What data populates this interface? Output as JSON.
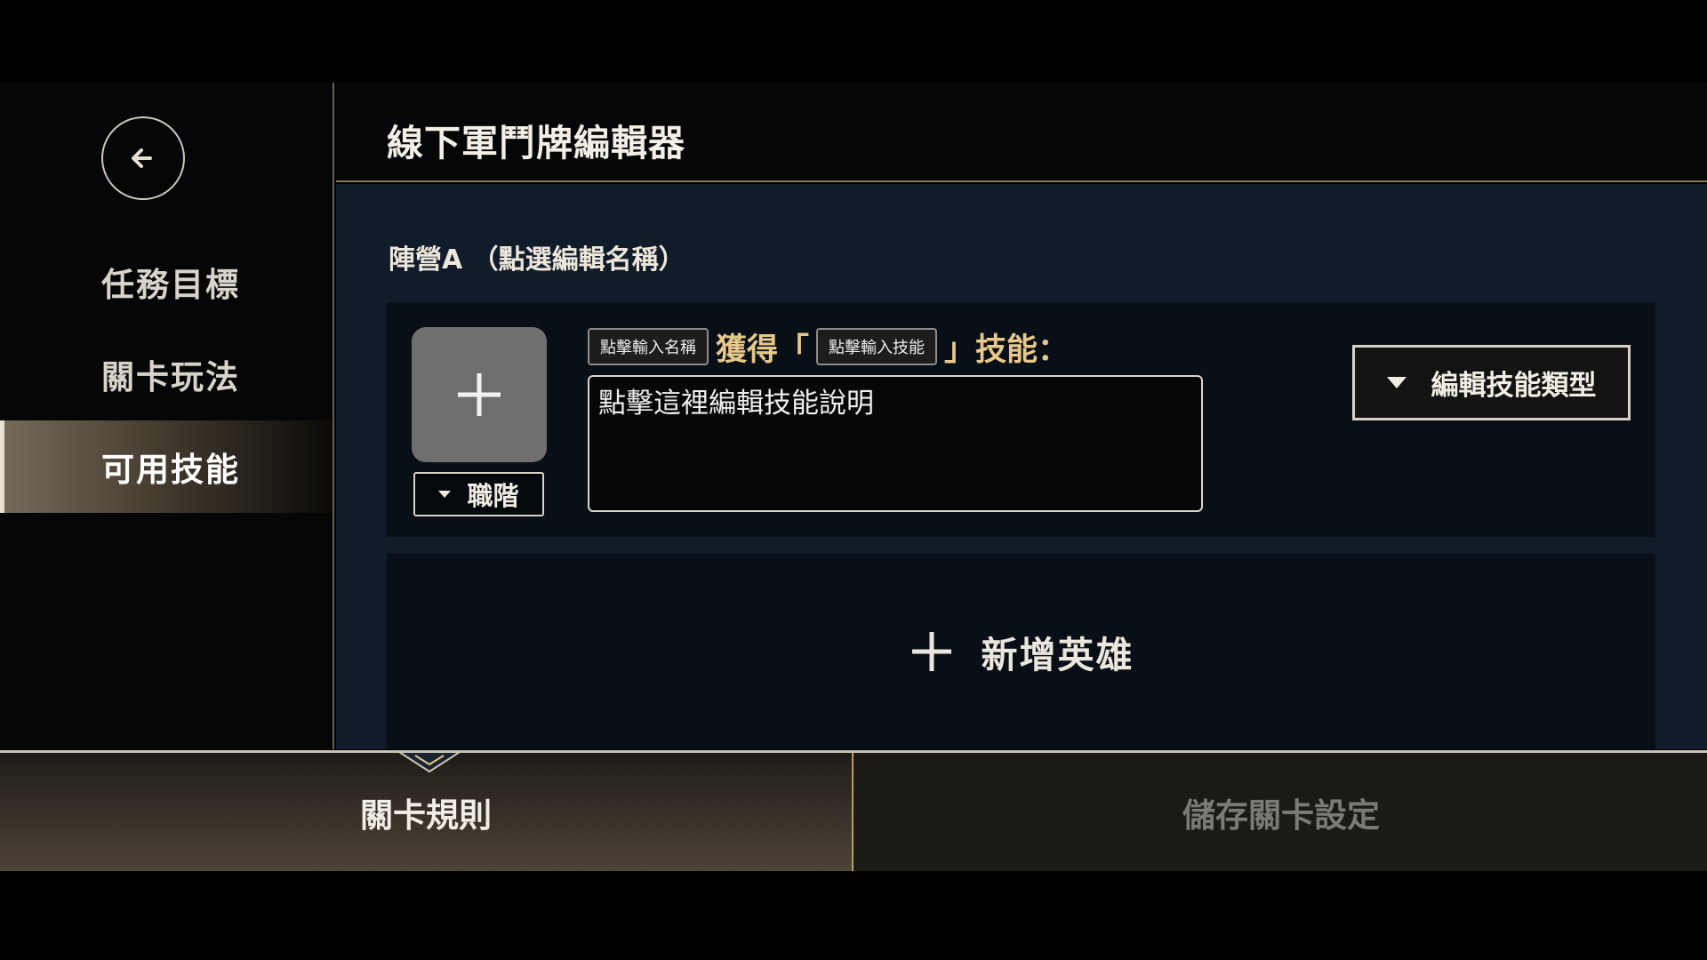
{
  "sidebar": {
    "back_icon": "arrow-left-icon",
    "items": [
      {
        "label": "任務目標",
        "active": false
      },
      {
        "label": "關卡玩法",
        "active": false
      },
      {
        "label": "可用技能",
        "active": true
      }
    ]
  },
  "header": {
    "title": "線下軍鬥牌編輯器"
  },
  "main": {
    "team_title": "陣營A （點選編輯名稱）",
    "skill_card": {
      "hero_slot_icon": "plus-icon",
      "job_dropdown_label": "職階",
      "name_pill": "點擊輸入名稱",
      "gain_text": "獲得「",
      "skill_pill": "點擊輸入技能",
      "skill_suffix": "」技能：",
      "description": "點擊這裡編輯技能說明",
      "type_button_label": "編輯技能類型"
    },
    "add_hero_label": "新增英雄"
  },
  "bottom_tabs": {
    "rules_label": "關卡規則",
    "save_label": "儲存關卡設定"
  },
  "colors": {
    "accent_gold": "#e8c98c",
    "panel_bg": "#111c2a",
    "card_bg": "#090f17"
  }
}
